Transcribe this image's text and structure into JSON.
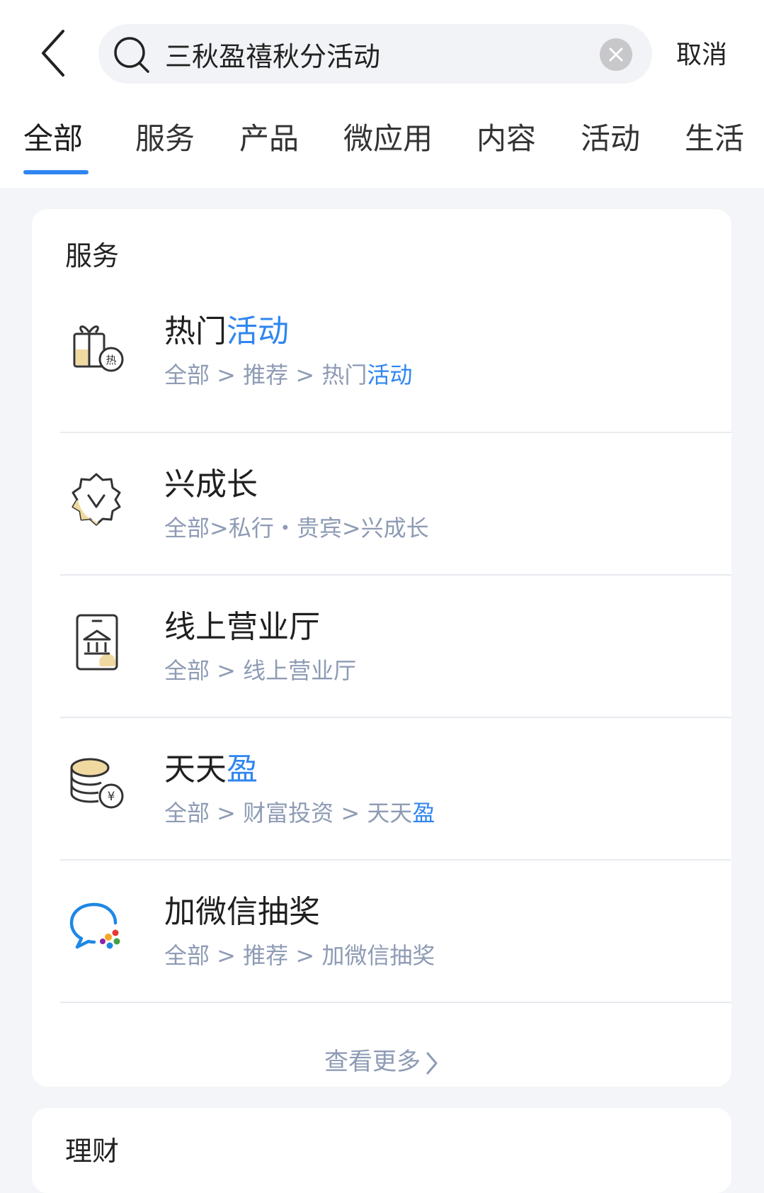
{
  "search": {
    "query": "三秋盈禧秋分活动",
    "cancel_label": "取消"
  },
  "tabs": [
    {
      "label": "全部",
      "active": true
    },
    {
      "label": "服务",
      "active": false
    },
    {
      "label": "产品",
      "active": false
    },
    {
      "label": "微应用",
      "active": false
    },
    {
      "label": "内容",
      "active": false
    },
    {
      "label": "活动",
      "active": false
    },
    {
      "label": "生活",
      "active": false
    }
  ],
  "services": {
    "section_title": "服务",
    "items": [
      {
        "icon": "gift-hot-icon",
        "title_plain": "热门",
        "title_highlight": "活动",
        "path_plain": "全部 > 推荐 > 热门",
        "path_highlight": "活动"
      },
      {
        "icon": "badge-growth-icon",
        "title_plain": "兴成长",
        "title_highlight": "",
        "path_plain": "全部>私行・贵宾>兴成长",
        "path_highlight": ""
      },
      {
        "icon": "phone-bank-icon",
        "title_plain": "线上营业厅",
        "title_highlight": "",
        "path_plain": "全部 > 线上营业厅",
        "path_highlight": ""
      },
      {
        "icon": "coins-yuan-icon",
        "title_plain": "天天",
        "title_highlight": "盈",
        "path_plain": "全部 > 财富投资 > 天天",
        "path_highlight": "盈"
      },
      {
        "icon": "wechat-chat-icon",
        "title_plain": "加微信抽奖",
        "title_highlight": "",
        "path_plain": "全部 > 推荐 > 加微信抽奖",
        "path_highlight": ""
      }
    ],
    "more_label": "查看更多"
  },
  "wealth": {
    "section_title": "理财"
  },
  "colors": {
    "accent": "#2f86f0",
    "path_text": "#8e9bb4",
    "background": "#f3f5f8"
  }
}
